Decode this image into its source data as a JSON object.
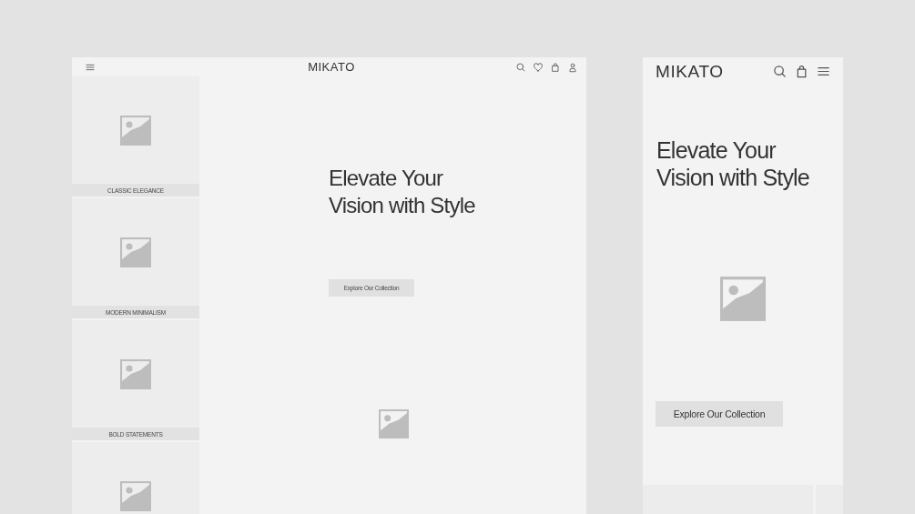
{
  "desktop": {
    "brand": "MIKATO",
    "categories": [
      {
        "kind": "labeled",
        "label": "CLASSIC ELEGANCE"
      },
      {
        "kind": "labeled",
        "label": "MODERN MINIMALISM"
      },
      {
        "kind": "labeled",
        "label": "BOLD STATEMENTS"
      },
      {
        "kind": "picture"
      }
    ],
    "hero": {
      "title": "Elevate Your\nVision with Style",
      "button": "Explore Our Collection"
    }
  },
  "mobile": {
    "brand": "MIKATO",
    "hero": {
      "title": "Elevate Your\nVision with Style",
      "button": "Explore Our Collection"
    }
  }
}
